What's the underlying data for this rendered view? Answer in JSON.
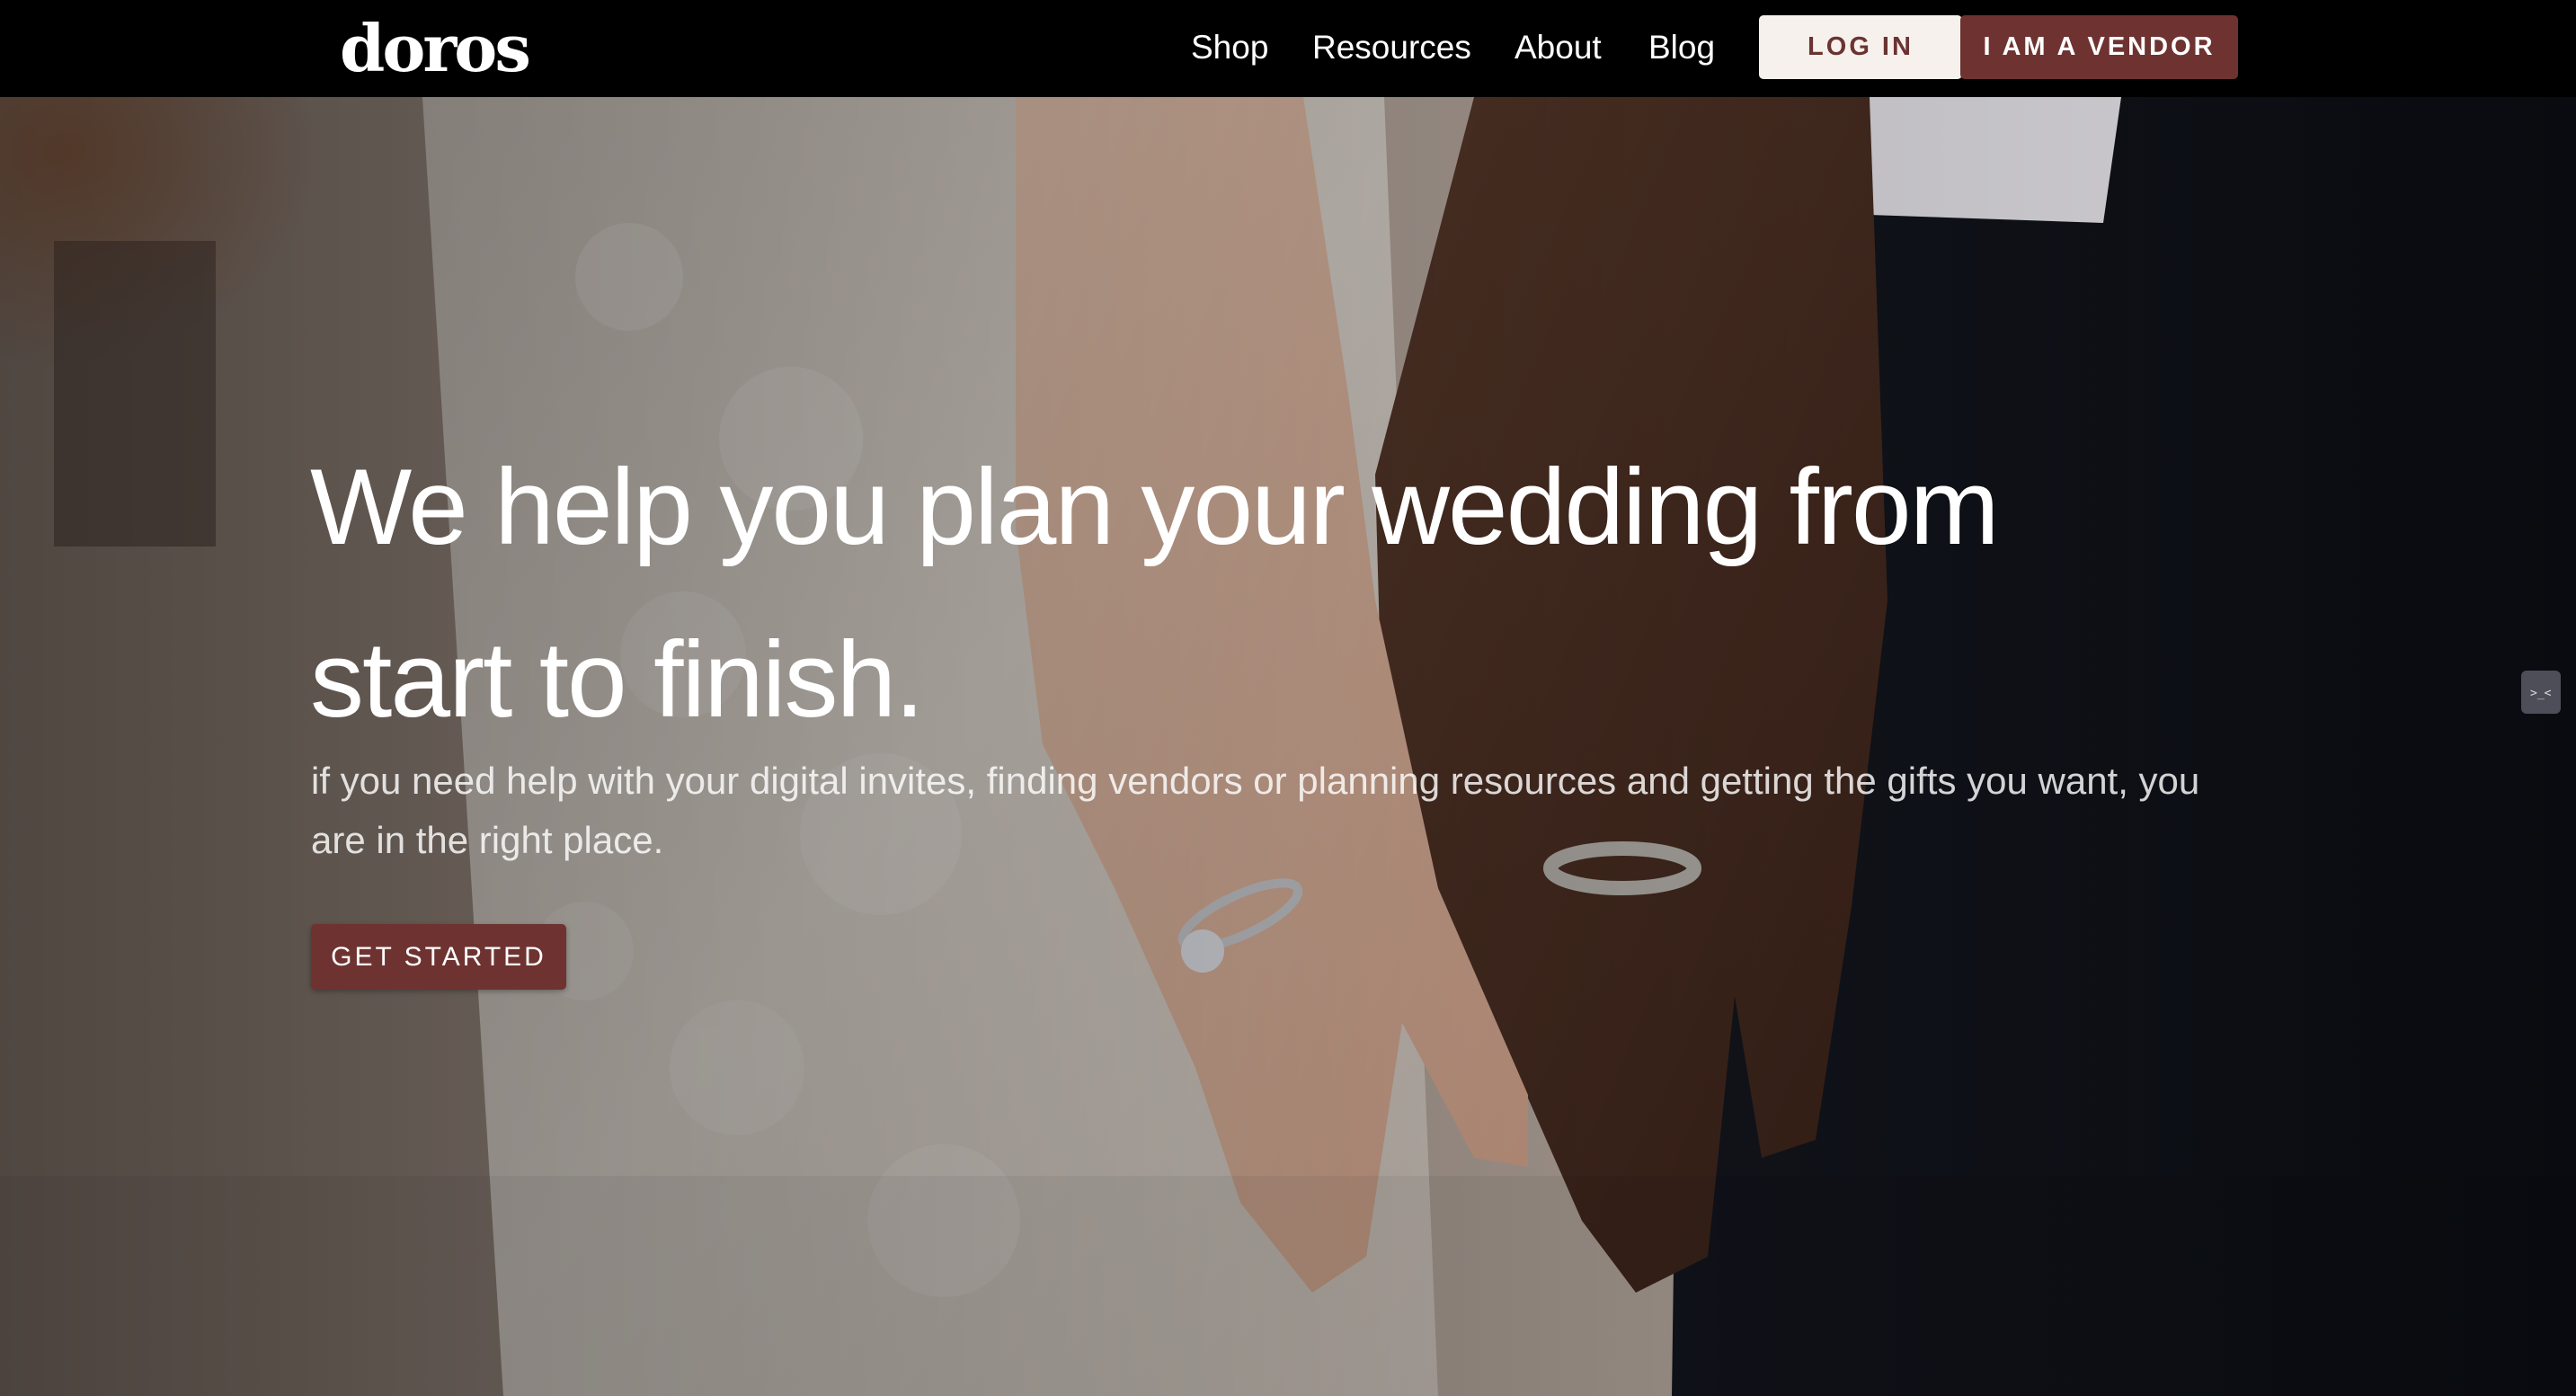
{
  "brand": {
    "logo": "doros"
  },
  "nav": {
    "links": [
      "Shop",
      "Resources",
      "About",
      "Blog"
    ],
    "login_label": "LOG IN",
    "vendor_label": "I AM A VENDOR"
  },
  "hero": {
    "title": "We help you plan your wedding from start to finish.",
    "subtitle": "if you need help with your digital invites, finding vendors or planning resources and getting the gifts you want, you are in the right place.",
    "cta_label": "GET STARTED",
    "image_icon": "couple-holding-hands-photo"
  },
  "widget": {
    "icon": "chat-bubble-icon"
  },
  "colors": {
    "brand_primary": "#6e3331",
    "login_bg": "#f6f1ec",
    "nav_bg": "#000000"
  }
}
